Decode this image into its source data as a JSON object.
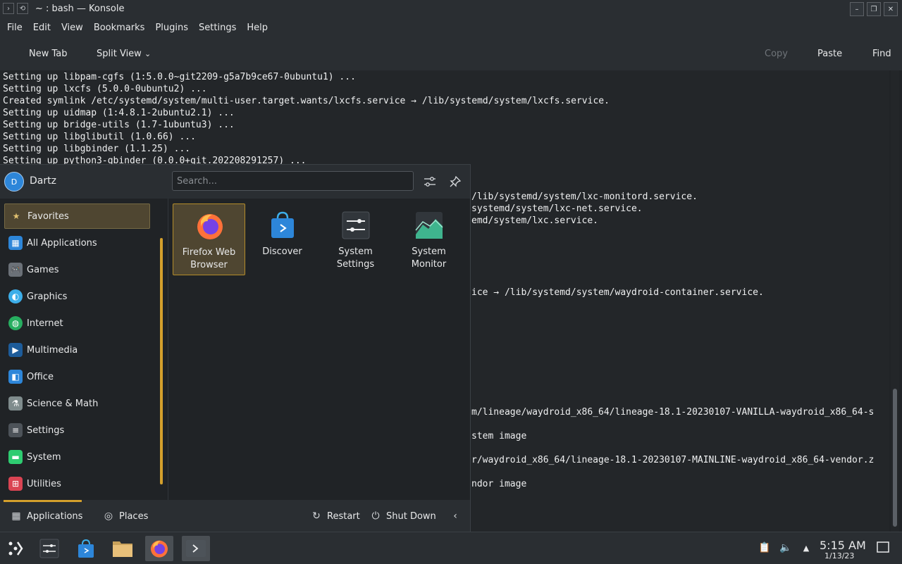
{
  "window": {
    "title": "~ : bash — Konsole"
  },
  "menubar": [
    "File",
    "Edit",
    "View",
    "Bookmarks",
    "Plugins",
    "Settings",
    "Help"
  ],
  "toolbar": {
    "new_tab": "New Tab",
    "split_view": "Split View",
    "copy": "Copy",
    "paste": "Paste",
    "find": "Find"
  },
  "terminal": {
    "lines": [
      "Setting up libpam-cgfs (1:5.0.0~git2209-g5a7b9ce67-0ubuntu1) ...",
      "Setting up lxcfs (5.0.0-0ubuntu2) ...",
      "Created symlink /etc/systemd/system/multi-user.target.wants/lxcfs.service → /lib/systemd/system/lxcfs.service.",
      "Setting up uidmap (1:4.8.1-2ubuntu2.1) ...",
      "Setting up bridge-utils (1.7-1ubuntu3) ...",
      "Setting up libglibutil (1.0.66) ...",
      "Setting up libgbinder (1.1.25) ...",
      "Setting up python3-gbinder (0.0.0+git.202208291257) ..."
    ],
    "right_fragments": [
      "/lib/systemd/system/lxc-monitord.service.",
      "systemd/system/lxc-net.service.",
      "emd/system/lxc.service.",
      "ice → /lib/systemd/system/waydroid-container.service.",
      "m/lineage/waydroid_x86_64/lineage-18.1-20230107-VANILLA-waydroid_x86_64-s",
      "stem image",
      "r/waydroid_x86_64/lineage-18.1-20230107-MAINLINE-waydroid_x86_64-vendor.z",
      "ndor image"
    ]
  },
  "launcher": {
    "user": {
      "initial": "D",
      "name": "Dartz"
    },
    "search_placeholder": "Search...",
    "categories": [
      {
        "label": "Favorites",
        "icon": "star-icon",
        "color": "#4f4631"
      },
      {
        "label": "All Applications",
        "icon": "grid-icon",
        "color": "#2d86d9"
      },
      {
        "label": "Games",
        "icon": "gamepad-icon",
        "color": "#6b7178"
      },
      {
        "label": "Graphics",
        "icon": "graphics-icon",
        "color": "#3daee9"
      },
      {
        "label": "Internet",
        "icon": "globe-icon",
        "color": "#27ae60"
      },
      {
        "label": "Multimedia",
        "icon": "multimedia-icon",
        "color": "#2d86d9"
      },
      {
        "label": "Office",
        "icon": "office-icon",
        "color": "#2d86d9"
      },
      {
        "label": "Science & Math",
        "icon": "science-icon",
        "color": "#7f8c8d"
      },
      {
        "label": "Settings",
        "icon": "settings-icon",
        "color": "#4d5359"
      },
      {
        "label": "System",
        "icon": "system-icon",
        "color": "#2ecc71"
      },
      {
        "label": "Utilities",
        "icon": "toolbox-icon",
        "color": "#da4453"
      }
    ],
    "apps": [
      {
        "label": "Firefox Web\nBrowser",
        "icon": "firefox-icon"
      },
      {
        "label": "Discover",
        "icon": "discover-icon"
      },
      {
        "label": "System\nSettings",
        "icon": "system-settings-icon"
      },
      {
        "label": "System\nMonitor",
        "icon": "system-monitor-icon"
      }
    ],
    "footer": {
      "applications": "Applications",
      "places": "Places",
      "restart": "Restart",
      "shutdown": "Shut Down"
    }
  },
  "taskbar": {
    "items": [
      "app-launcher-icon",
      "system-settings-icon",
      "discover-icon",
      "file-manager-icon",
      "firefox-icon",
      "konsole-icon"
    ],
    "clock": {
      "time": "5:15 AM",
      "date": "1/13/23"
    }
  }
}
